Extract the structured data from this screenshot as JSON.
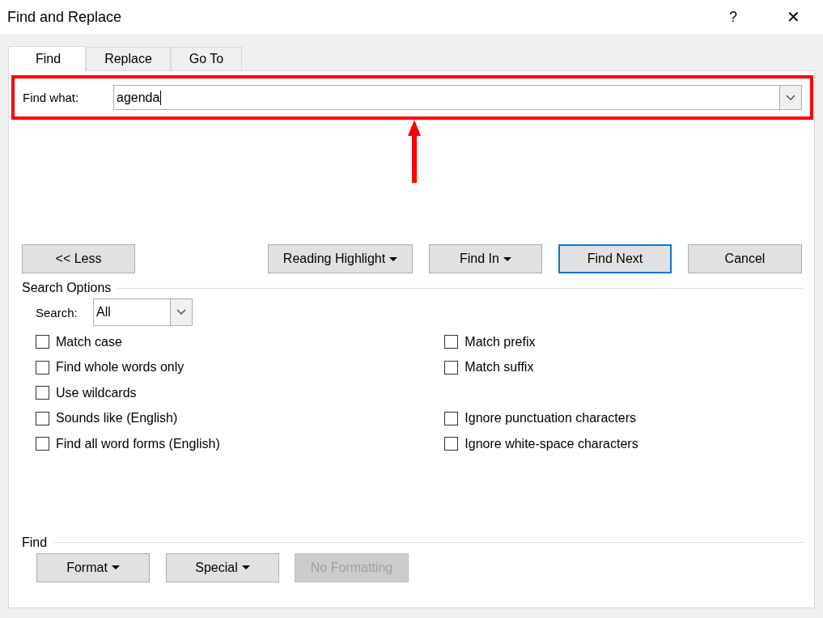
{
  "window": {
    "title": "Find and Replace",
    "help": "?",
    "close": "✕"
  },
  "tabs": [
    {
      "label": "Find",
      "selected": true
    },
    {
      "label": "Replace",
      "selected": false
    },
    {
      "label": "Go To",
      "selected": false
    }
  ],
  "find_what": {
    "label": "Find what:",
    "value": "agenda",
    "outlined": true,
    "arrow": true
  },
  "buttons": [
    {
      "label": "<< Less",
      "dropdown": false,
      "default": false
    },
    {
      "label": "Reading Highlight",
      "dropdown": true,
      "default": false
    },
    {
      "label": "Find In",
      "dropdown": true,
      "default": false
    },
    {
      "label": "Find Next",
      "dropdown": false,
      "default": true
    },
    {
      "label": "Cancel",
      "dropdown": false,
      "default": false
    }
  ],
  "search_options": {
    "title": "Search Options",
    "search_label": "Search:",
    "search_value": "All",
    "left": [
      {
        "label": "Match case",
        "checked": false
      },
      {
        "label": "Find whole words only",
        "checked": false
      },
      {
        "label": "Use wildcards",
        "checked": false
      },
      {
        "label": "Sounds like (English)",
        "checked": false
      },
      {
        "label": "Find all word forms (English)",
        "checked": false
      }
    ],
    "right_groups": [
      [
        {
          "label": "Match prefix",
          "checked": false
        },
        {
          "label": "Match suffix",
          "checked": false
        }
      ],
      [
        {
          "label": "Ignore punctuation characters",
          "checked": false
        },
        {
          "label": "Ignore white-space characters",
          "checked": false
        }
      ]
    ]
  },
  "find_section": {
    "title": "Find",
    "buttons": [
      {
        "label": "Format",
        "dropdown": true,
        "disabled": false
      },
      {
        "label": "Special",
        "dropdown": true,
        "disabled": false
      },
      {
        "label": "No Formatting",
        "dropdown": false,
        "disabled": true
      }
    ]
  }
}
